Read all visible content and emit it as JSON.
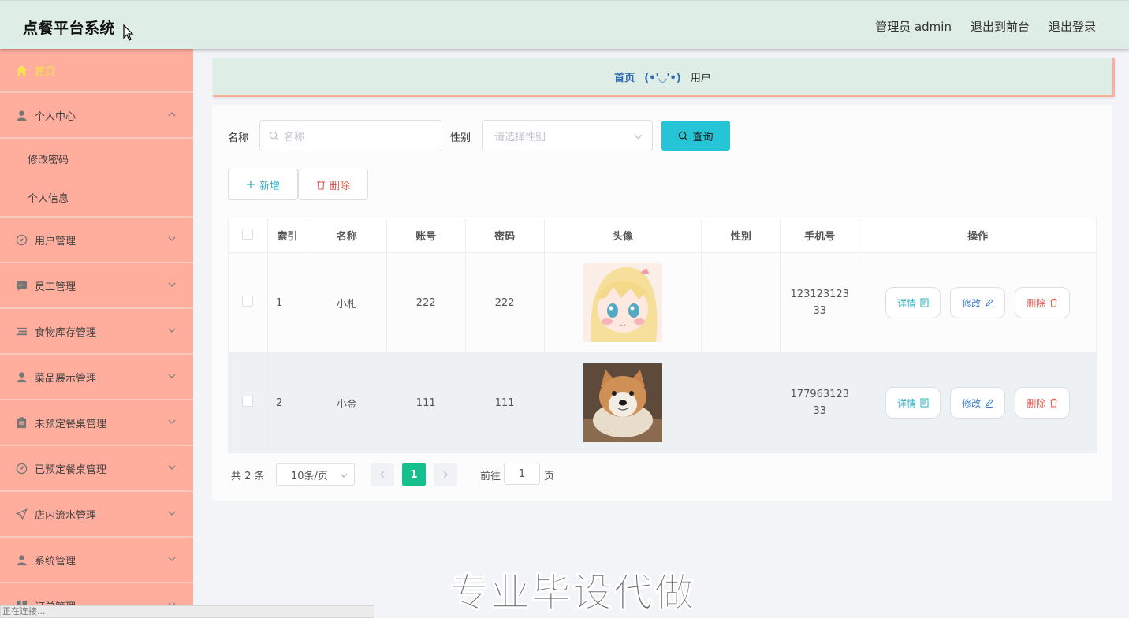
{
  "header": {
    "app_title": "点餐平台系统",
    "admin_label": "管理员 admin",
    "to_front": "退出到前台",
    "logout": "退出登录"
  },
  "sidebar": {
    "home": "首页",
    "personal": {
      "label": "个人中心",
      "children": [
        "修改密码",
        "个人信息"
      ]
    },
    "items": [
      "用户管理",
      "员工管理",
      "食物库存管理",
      "菜品展示管理",
      "未预定餐桌管理",
      "已预定餐桌管理",
      "店内流水管理",
      "系统管理",
      "订单管理"
    ]
  },
  "breadcrumb": {
    "home": "首页",
    "face": "(•'◡'•)",
    "current": "用户"
  },
  "search": {
    "name_label": "名称",
    "name_placeholder": "名称",
    "gender_label": "性别",
    "gender_placeholder": "请选择性别",
    "query_button": "查询"
  },
  "actions": {
    "add": "新增",
    "delete": "删除"
  },
  "table": {
    "headers": [
      "索引",
      "名称",
      "账号",
      "密码",
      "头像",
      "性别",
      "手机号",
      "操作"
    ],
    "rows": [
      {
        "index": "1",
        "name": "小札",
        "account": "222",
        "password": "222",
        "gender": "",
        "phone_line1": "123123123",
        "phone_line2": "33"
      },
      {
        "index": "2",
        "name": "小金",
        "account": "111",
        "password": "111",
        "gender": "",
        "phone_line1": "177963123",
        "phone_line2": "33"
      }
    ],
    "op_detail": "详情",
    "op_edit": "修改",
    "op_delete": "删除"
  },
  "pagination": {
    "total": "共 2 条",
    "page_size": "10条/页",
    "current_page": "1",
    "goto_label": "前往",
    "goto_value": "1",
    "goto_unit": "页"
  },
  "watermark": "专业毕设代做",
  "status_bar": "正在连接...",
  "colors": {
    "header_bg": "#deeee6",
    "sidebar_bg": "#ffad9d",
    "query_button": "#25c4d6",
    "page_active": "#15c08c",
    "delete_red": "#e5534b",
    "detail_teal": "#2bb0c4",
    "edit_blue": "#3e7fd0"
  }
}
